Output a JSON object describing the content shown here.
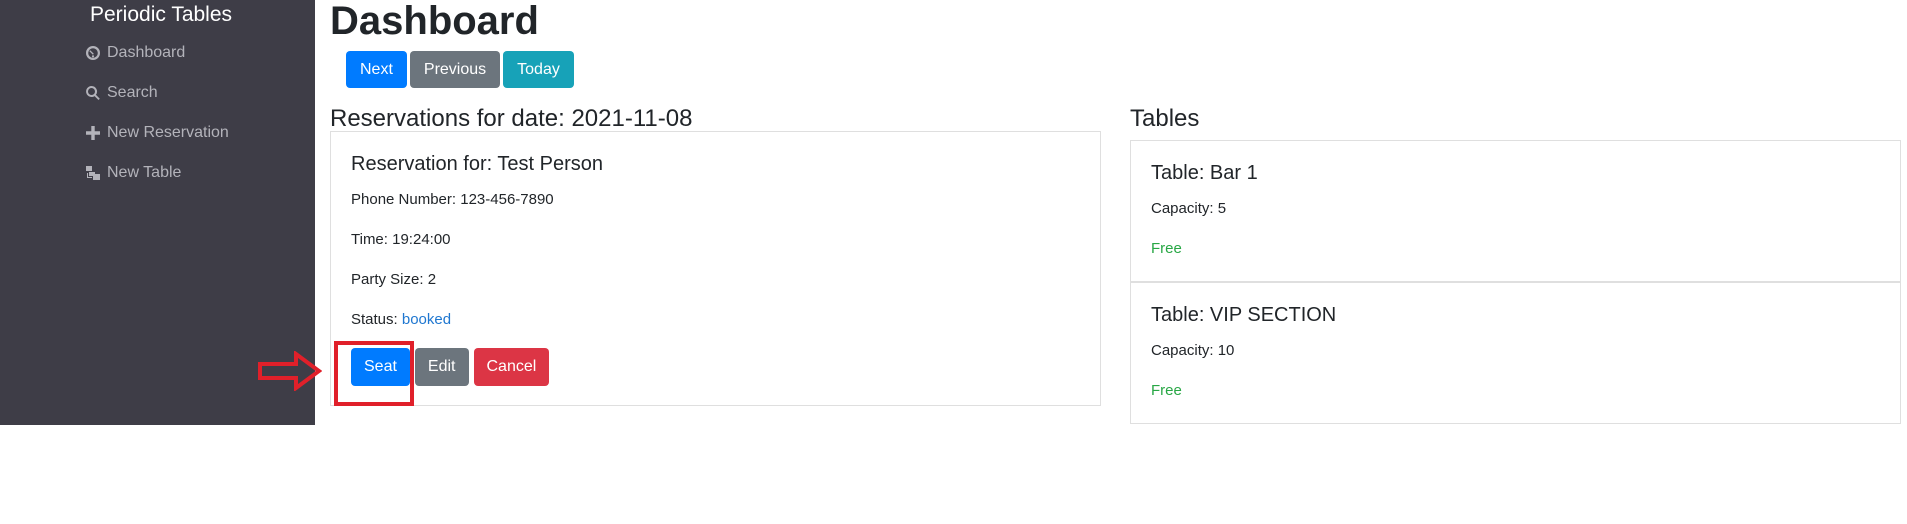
{
  "sidebar": {
    "brand": "Periodic Tables",
    "items": [
      {
        "label": "Dashboard",
        "icon": "dashboard-icon"
      },
      {
        "label": "Search",
        "icon": "search-icon"
      },
      {
        "label": "New Reservation",
        "icon": "plus-icon"
      },
      {
        "label": "New Table",
        "icon": "table-icon"
      }
    ]
  },
  "main": {
    "title": "Dashboard",
    "nav_buttons": {
      "next": "Next",
      "previous": "Previous",
      "today": "Today"
    },
    "reservations_heading": "Reservations for date: 2021-11-08",
    "tables_heading": "Tables"
  },
  "reservation": {
    "title": "Reservation for: Test Person",
    "phone_label": "Phone Number:",
    "phone": "123-456-7890",
    "time_label": "Time:",
    "time": "19:24:00",
    "party_label": "Party Size:",
    "party": "2",
    "status_label": "Status:",
    "status": "booked",
    "actions": {
      "seat": "Seat",
      "edit": "Edit",
      "cancel": "Cancel"
    }
  },
  "tables": [
    {
      "title": "Table: Bar 1",
      "capacity_label": "Capacity:",
      "capacity": "5",
      "status": "Free"
    },
    {
      "title": "Table: VIP SECTION",
      "capacity_label": "Capacity:",
      "capacity": "10",
      "status": "Free"
    }
  ],
  "colors": {
    "sidebar_bg": "#3e3d47",
    "primary": "#007bff",
    "secondary": "#6c757d",
    "info": "#17a2b8",
    "danger": "#dc3545",
    "free": "#28a745",
    "annotation": "#e0202a"
  }
}
